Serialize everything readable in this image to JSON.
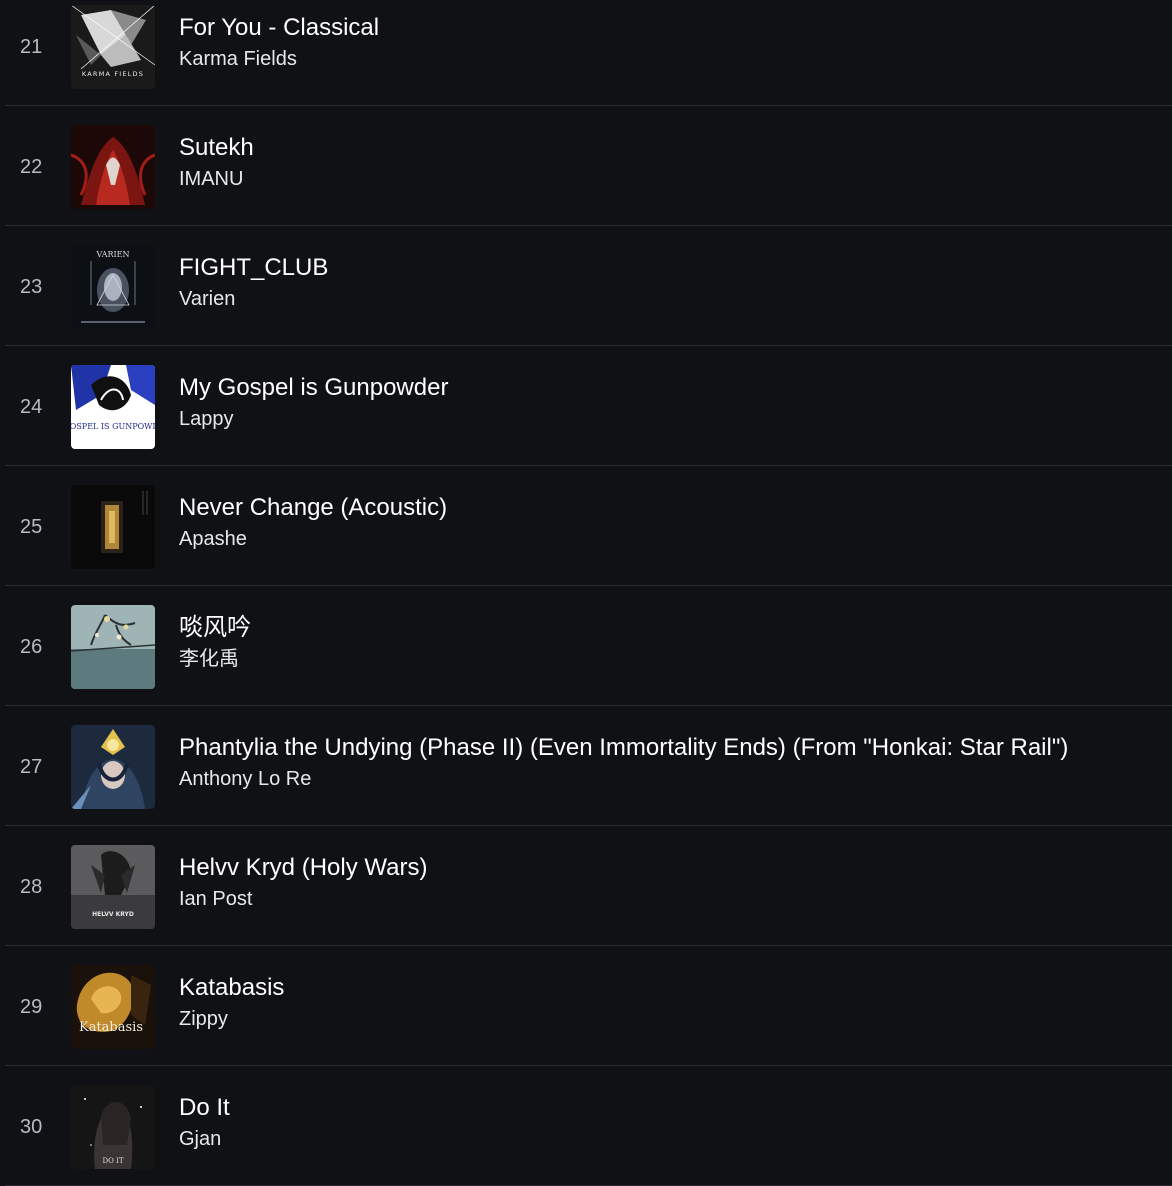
{
  "tracks": [
    {
      "number": "21",
      "title": "For You - Classical",
      "artist": "Karma Fields",
      "art_text": "KARMA FIELDS"
    },
    {
      "number": "22",
      "title": "Sutekh",
      "artist": "IMANU",
      "art_text": ""
    },
    {
      "number": "23",
      "title": "FIGHT_CLUB",
      "artist": "Varien",
      "art_text": "VARIEN"
    },
    {
      "number": "24",
      "title": "My Gospel is Gunpowder",
      "artist": "Lappy",
      "art_text": "GOSPEL IS GUNPOWDER"
    },
    {
      "number": "25",
      "title": "Never Change (Acoustic)",
      "artist": "Apashe",
      "art_text": ""
    },
    {
      "number": "26",
      "title": "啖风吟",
      "artist": "李化禹",
      "art_text": ""
    },
    {
      "number": "27",
      "title": "Phantylia the Undying (Phase II) (Even Immortality Ends) (From \"Honkai: Star Rail\")",
      "artist": "Anthony Lo Re",
      "art_text": ""
    },
    {
      "number": "28",
      "title": "Helvv Kryd (Holy Wars)",
      "artist": "Ian Post",
      "art_text": "HELVV KRYD"
    },
    {
      "number": "29",
      "title": "Katabasis",
      "artist": "Zippy",
      "art_text": "Katabasis"
    },
    {
      "number": "30",
      "title": "Do It",
      "artist": "Gjan",
      "art_text": "DO IT"
    }
  ]
}
